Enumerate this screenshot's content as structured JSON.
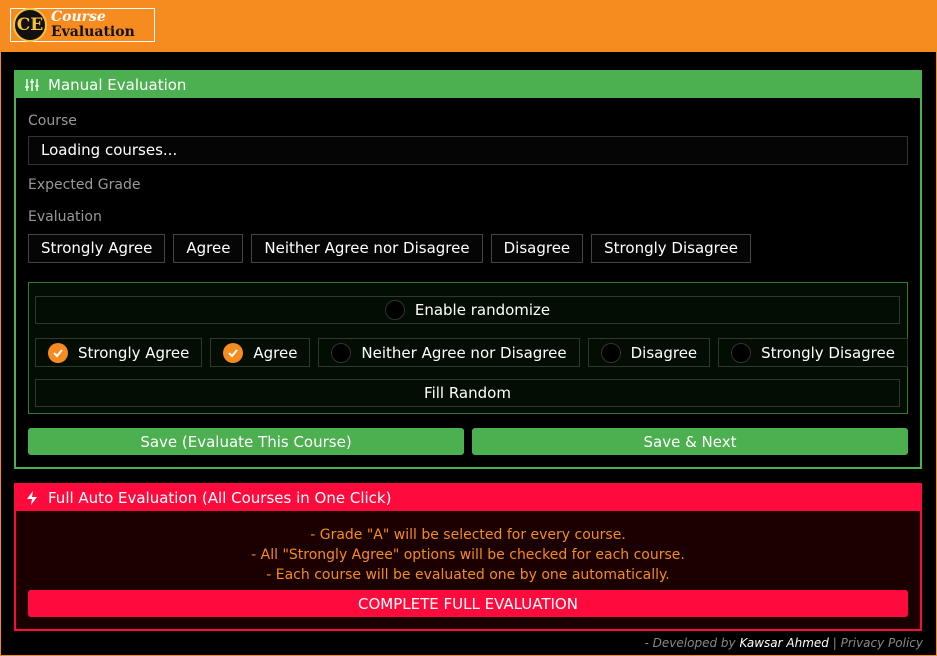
{
  "header": {
    "logo_badge": "CE",
    "logo_line1": "Course",
    "logo_line2": "Evaluation",
    "brand_color": "#f68b1f"
  },
  "manual": {
    "title": "Manual Evaluation",
    "icon": "sliders-icon",
    "accent": "#4caf50",
    "course_label": "Course",
    "course_value": "Loading courses...",
    "grade_label": "Expected Grade",
    "evaluation_label": "Evaluation",
    "evaluation_options": [
      "Strongly Agree",
      "Agree",
      "Neither Agree nor Disagree",
      "Disagree",
      "Strongly Disagree"
    ],
    "enable_randomize": "Enable randomize",
    "random_options": [
      {
        "label": "Strongly Agree",
        "checked": true
      },
      {
        "label": "Agree",
        "checked": true
      },
      {
        "label": "Neither Agree nor Disagree",
        "checked": false
      },
      {
        "label": "Disagree",
        "checked": false
      },
      {
        "label": "Strongly Disagree",
        "checked": false
      }
    ],
    "fill_random": "Fill Random",
    "save_button": "Save (Evaluate This Course)",
    "save_next_button": "Save & Next"
  },
  "auto": {
    "title": "Full Auto Evaluation (All Courses in One Click)",
    "icon": "bolt-icon",
    "accent": "#ff0a3c",
    "lines": [
      "- Grade \"A\" will be selected for every course.",
      "- All \"Strongly Agree\" options will be checked for each course.",
      "- Each course will be evaluated one by one automatically."
    ],
    "complete_button": "COMPLETE FULL EVALUATION"
  },
  "footer": {
    "prefix": "- Developed by ",
    "author": "Kawsar Ahmed",
    "sep": " | ",
    "privacy": "Privacy Policy"
  }
}
